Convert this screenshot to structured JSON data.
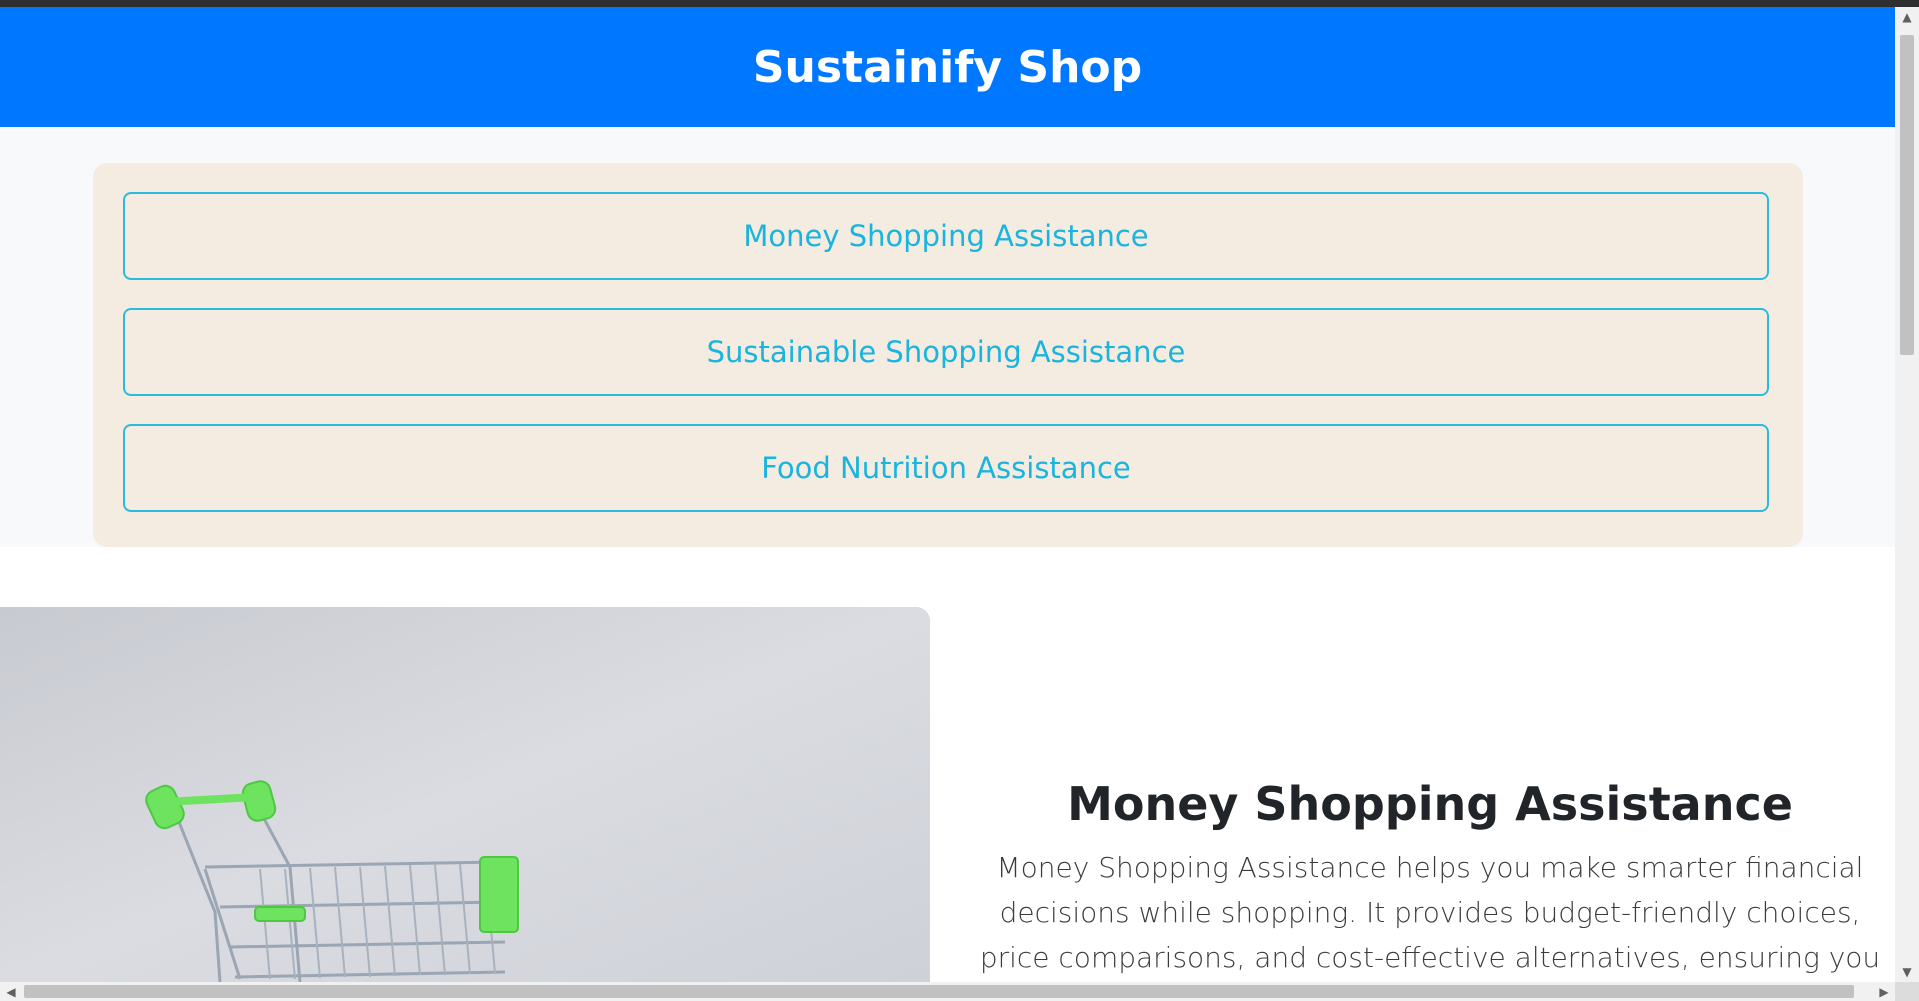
{
  "header": {
    "title": "Sustainify Shop"
  },
  "nav": {
    "buttons": [
      {
        "label": "Money Shopping Assistance"
      },
      {
        "label": "Sustainable Shopping Assistance"
      },
      {
        "label": "Food Nutrition Assistance"
      }
    ]
  },
  "hero": {
    "image_alt": "shopping-cart-image",
    "title": "Money Shopping Assistance",
    "description": "Money Shopping Assistance helps you make smarter financial decisions while shopping. It provides budget-friendly choices, price comparisons, and cost-effective alternatives, ensuring you get the best value for your"
  },
  "colors": {
    "header_bg": "#0077ff",
    "panel_bg": "#f4ece1",
    "button_border": "#2bbbe0",
    "button_text": "#1ab4de"
  },
  "icons": {
    "scroll_up": "triangle-up-icon",
    "scroll_down": "triangle-down-icon",
    "scroll_left": "triangle-left-icon",
    "scroll_right": "triangle-right-icon"
  }
}
